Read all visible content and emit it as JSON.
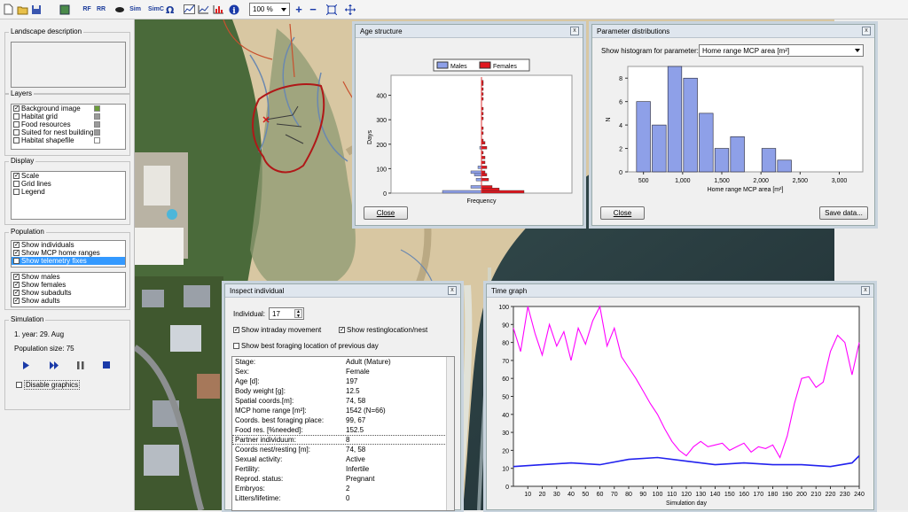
{
  "toolbar": {
    "rf": "RF",
    "rr": "RR",
    "sim": "Sim",
    "simc": "SimC",
    "zoom": "100 %"
  },
  "left": {
    "landscape": {
      "label": "Landscape description"
    },
    "layers": {
      "label": "Layers",
      "items": [
        {
          "label": "Background image",
          "checked": true,
          "swatch": "#6b9c3a"
        },
        {
          "label": "Habitat grid",
          "checked": false,
          "swatch": "#9a9a9a"
        },
        {
          "label": "Food resources",
          "checked": false,
          "swatch": "#9a9a9a"
        },
        {
          "label": "Suited for nest building",
          "checked": false,
          "swatch": "#9a9a9a"
        },
        {
          "label": "Habitat shapefile",
          "checked": false,
          "swatch": "#ffffff"
        }
      ]
    },
    "display": {
      "label": "Display",
      "items": [
        {
          "label": "Scale",
          "checked": true
        },
        {
          "label": "Grid lines",
          "checked": false
        },
        {
          "label": "Legend",
          "checked": false
        }
      ]
    },
    "population": {
      "label": "Population",
      "items1": [
        {
          "label": "Show individuals",
          "checked": true
        },
        {
          "label": "Show MCP home ranges",
          "checked": true
        },
        {
          "label": "Show telemetry fixes",
          "checked": false
        }
      ],
      "items2": [
        {
          "label": "Show males",
          "checked": true
        },
        {
          "label": "Show females",
          "checked": true
        },
        {
          "label": "Show subadults",
          "checked": true
        },
        {
          "label": "Show adults",
          "checked": true
        }
      ]
    },
    "simulation": {
      "label": "Simulation",
      "year": "1. year: 29. Aug",
      "popsize": "Population size: 75",
      "disable": "Disable graphics"
    }
  },
  "age": {
    "title": "Age structure",
    "legend": [
      "Males",
      "Females"
    ],
    "ylabel": "Days",
    "xlabel": "Frequency",
    "yticks": [
      "400",
      "300",
      "200",
      "100",
      "0"
    ],
    "close": "Close"
  },
  "param": {
    "title": "Parameter distributions",
    "label": "Show histogram for parameter:",
    "select": "Home range MCP area [m²]",
    "close": "Close",
    "save": "Save data..."
  },
  "inspect": {
    "title": "Inspect individual",
    "ind_label": "Individual:",
    "ind_value": "17",
    "checks": [
      {
        "label": "Show intraday movement",
        "checked": true
      },
      {
        "label": "Show restinglocation/nest",
        "checked": true
      },
      {
        "label": "Show best foraging location of previous day",
        "checked": false
      }
    ],
    "table": [
      [
        "Stage:",
        "Adult (Mature)"
      ],
      [
        "Sex:",
        "Female"
      ],
      [
        "Age [d]:",
        "197"
      ],
      [
        "Body weight [g]:",
        "12.5"
      ],
      [
        "Spatial coords.[m]:",
        "74, 58"
      ],
      [
        "MCP home range [m²]:",
        "1542 (N=66)"
      ],
      [
        "Coords. best foraging place:",
        "99, 67"
      ],
      [
        "Food res. [%needed]:",
        "152.5"
      ],
      [
        "Partner individuum:",
        "8"
      ],
      [
        "Coords nest/resting [m]:",
        "74, 58"
      ],
      [
        "Sexual activity:",
        "Active"
      ],
      [
        "Fertility:",
        "Infertile"
      ],
      [
        "Reprod. status:",
        "Pregnant"
      ],
      [
        "Embryos:",
        "2"
      ],
      [
        "Litters/lifetime:",
        "0"
      ]
    ]
  },
  "time": {
    "title": "Time graph"
  },
  "chart_data": [
    {
      "type": "bar",
      "title": "Age structure",
      "ylabel": "Days",
      "xlabel": "Frequency",
      "ylim": [
        0,
        460
      ],
      "series": [
        {
          "name": "Males",
          "color": "#8ea0e8",
          "bars": [
            [
              0,
              22
            ],
            [
              20,
              6
            ],
            [
              50,
              3
            ],
            [
              70,
              4
            ],
            [
              80,
              6
            ],
            [
              100,
              2
            ],
            [
              180,
              1
            ]
          ]
        },
        {
          "name": "Females",
          "color": "#e0161e",
          "bars": [
            [
              0,
              24
            ],
            [
              10,
              10
            ],
            [
              20,
              6
            ],
            [
              50,
              4
            ],
            [
              70,
              3
            ],
            [
              80,
              2
            ],
            [
              100,
              3
            ],
            [
              120,
              2
            ],
            [
              140,
              2
            ],
            [
              160,
              1
            ],
            [
              180,
              3
            ],
            [
              200,
              2
            ],
            [
              210,
              1
            ],
            [
              240,
              1
            ],
            [
              260,
              1
            ],
            [
              300,
              1
            ],
            [
              320,
              1
            ],
            [
              340,
              1
            ],
            [
              380,
              1
            ],
            [
              400,
              1
            ],
            [
              420,
              1
            ],
            [
              440,
              1
            ],
            [
              450,
              1
            ]
          ]
        }
      ]
    },
    {
      "type": "bar",
      "title": "Parameter distributions",
      "xlabel": "Home range MCP area [m²]",
      "ylabel": "N",
      "x_ticks": [
        "500",
        "1,000",
        "1,500",
        "2,000",
        "2,500",
        "3,000"
      ],
      "y_ticks": [
        "0",
        "2",
        "4",
        "6",
        "8"
      ],
      "ylim": [
        0,
        9
      ],
      "bins": [
        [
          400,
          600
        ],
        [
          600,
          800
        ],
        [
          800,
          1000
        ],
        [
          1000,
          1200
        ],
        [
          1200,
          1400
        ],
        [
          1400,
          1600
        ],
        [
          1600,
          1800
        ],
        [
          1800,
          2000
        ],
        [
          2000,
          2200
        ],
        [
          2200,
          2400
        ],
        [
          2400,
          2600
        ],
        [
          2600,
          2800
        ]
      ],
      "values": [
        6,
        4,
        9,
        8,
        5,
        2,
        3,
        0,
        2,
        1,
        0,
        0
      ]
    },
    {
      "type": "line",
      "xlabel": "Simulation day",
      "xlim": [
        0,
        240
      ],
      "ylim": [
        0,
        100
      ],
      "x_ticks": [
        "10",
        "20",
        "30",
        "40",
        "50",
        "60",
        "70",
        "80",
        "90",
        "100",
        "110",
        "120",
        "130",
        "140",
        "150",
        "160",
        "170",
        "180",
        "190",
        "200",
        "210",
        "220",
        "230",
        "240"
      ],
      "y_ticks": [
        "0",
        "10",
        "20",
        "30",
        "40",
        "50",
        "60",
        "70",
        "80",
        "90",
        "100"
      ],
      "series": [
        {
          "color": "#ff00ff",
          "x": [
            0,
            5,
            10,
            15,
            20,
            25,
            30,
            35,
            40,
            45,
            50,
            55,
            60,
            65,
            70,
            75,
            80,
            85,
            90,
            95,
            100,
            105,
            110,
            115,
            120,
            125,
            130,
            135,
            140,
            145,
            150,
            155,
            160,
            165,
            170,
            175,
            180,
            185,
            190,
            195,
            200,
            205,
            210,
            215,
            220,
            225,
            230,
            235,
            240
          ],
          "y": [
            88,
            75,
            100,
            85,
            73,
            90,
            78,
            86,
            70,
            88,
            79,
            92,
            100,
            78,
            88,
            72,
            66,
            60,
            53,
            46,
            40,
            32,
            25,
            20,
            17,
            22,
            25,
            22,
            23,
            24,
            20,
            22,
            24,
            19,
            22,
            21,
            23,
            16,
            28,
            46,
            60,
            61,
            55,
            58,
            75,
            84,
            80,
            62,
            80
          ]
        },
        {
          "color": "#2222ee",
          "x": [
            0,
            20,
            40,
            60,
            80,
            100,
            120,
            140,
            160,
            180,
            200,
            220,
            235,
            240
          ],
          "y": [
            11,
            12,
            13,
            12,
            15,
            16,
            14,
            12,
            13,
            12,
            12,
            11,
            13,
            17
          ]
        }
      ]
    }
  ]
}
